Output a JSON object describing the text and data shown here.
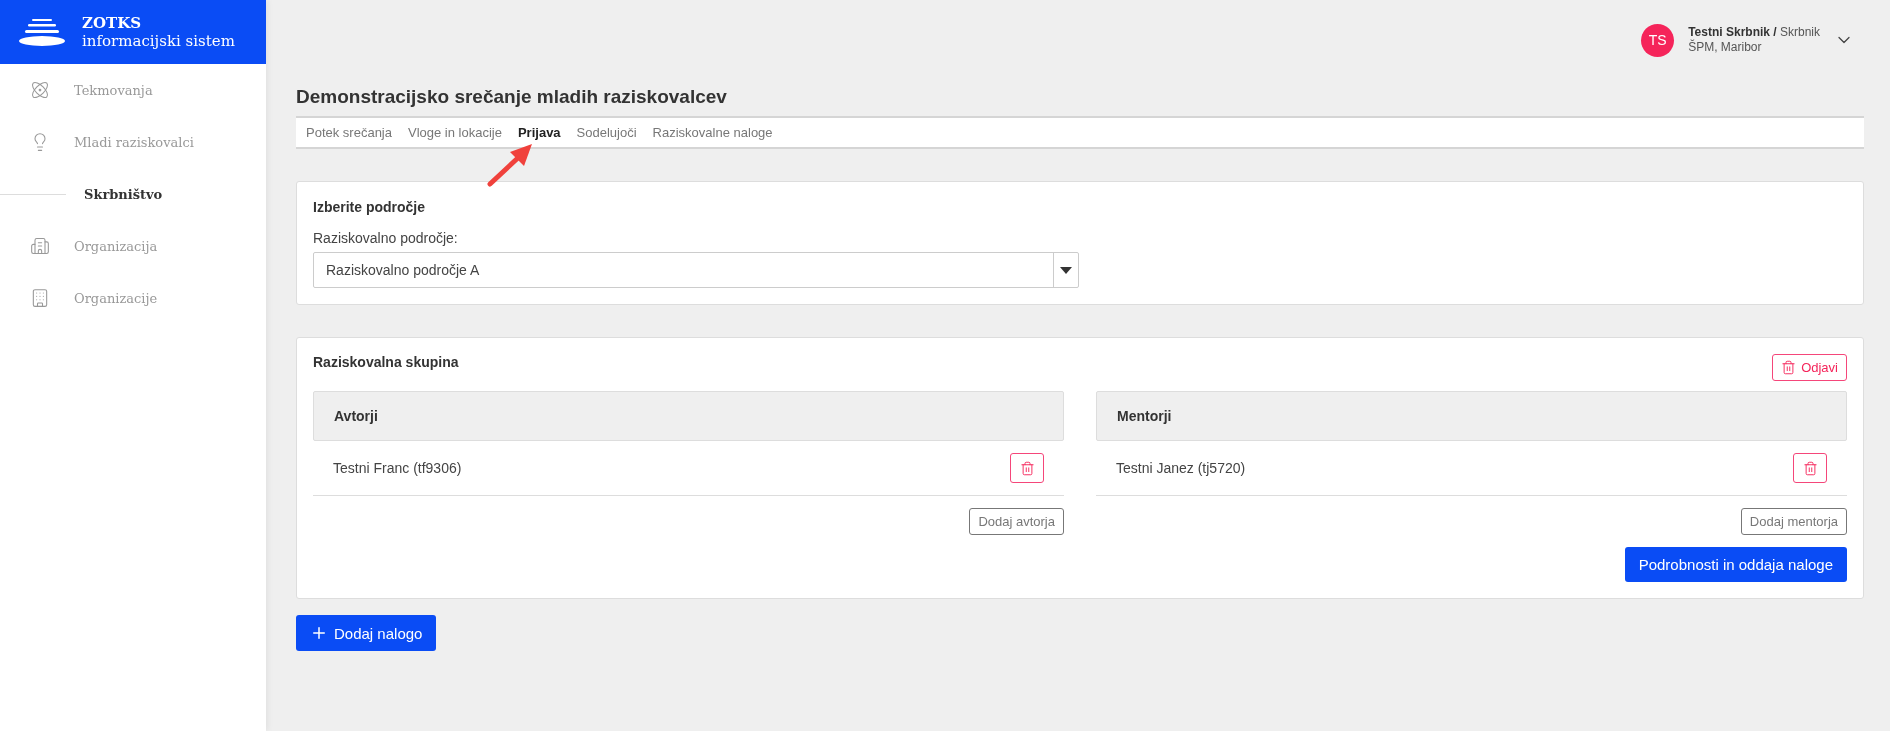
{
  "brand": {
    "name": "ZOTKS",
    "subtitle": "informacijski sistem"
  },
  "sidebar": {
    "items": [
      {
        "label": "Tekmovanja",
        "kind": "atom",
        "selected": false
      },
      {
        "label": "Mladi raziskovalci",
        "kind": "bulb",
        "selected": false
      },
      {
        "label": "Skrbništvo",
        "kind": "sub",
        "selected": true
      },
      {
        "label": "Organizacija",
        "kind": "building",
        "selected": false
      },
      {
        "label": "Organizacije",
        "kind": "city",
        "selected": false
      }
    ]
  },
  "user": {
    "initials": "TS",
    "name": "Testni Skrbnik /",
    "role": "Skrbnik",
    "org": "ŠPM, Maribor"
  },
  "page_title": "Demonstracijsko srečanje mladih raziskovalcev",
  "tabs": [
    {
      "label": "Potek srečanja",
      "selected": false
    },
    {
      "label": "Vloge in lokacije",
      "selected": false
    },
    {
      "label": "Prijava",
      "selected": true
    },
    {
      "label": "Sodelujoči",
      "selected": false
    },
    {
      "label": "Raziskovalne naloge",
      "selected": false
    }
  ],
  "area_card": {
    "title": "Izberite področje",
    "field_label": "Raziskovalno področje:",
    "value": "Raziskovalno področje A"
  },
  "group_card": {
    "title": "Raziskovalna skupina",
    "unregister_button": "Odjavi",
    "columns": [
      {
        "heading": "Avtorji",
        "members": [
          "Testni Franc (tf9306)"
        ],
        "add_button": "Dodaj avtorja"
      },
      {
        "heading": "Mentorji",
        "members": [
          "Testni Janez (tj5720)"
        ],
        "add_button": "Dodaj mentorja"
      }
    ],
    "submit_button": "Podrobnosti in oddaja naloge"
  },
  "add_task_button": "Dodaj nalogo"
}
